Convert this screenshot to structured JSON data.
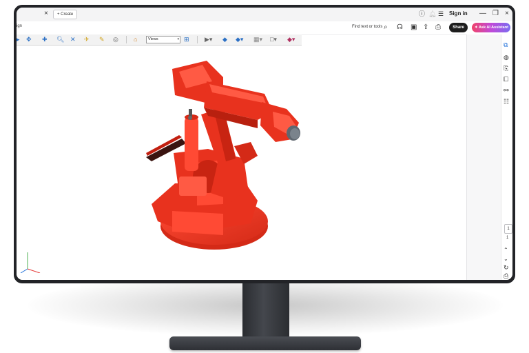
{
  "browser": {
    "tab_close": "×",
    "new_tab_label": "+ Create",
    "sign_in": "Sign in",
    "icons": [
      "info-icon",
      "bell-icon",
      "apps-grid-icon"
    ],
    "window_controls": [
      "—",
      "❐",
      "×"
    ]
  },
  "app_toolbar": {
    "title_fragment": "ign",
    "find_placeholder": "Find text or tools",
    "share_label": "Share",
    "ai_assistant_label": "Ask AI Assistant",
    "icons": [
      "search-icon",
      "headphones-icon",
      "save-icon",
      "upload-icon",
      "print-icon"
    ]
  },
  "toolbar3d": {
    "views_label": "Views",
    "tools": [
      "rotate-icon",
      "pan-icon",
      "zoom-icon",
      "walk-icon",
      "fly-icon",
      "measure-icon",
      "comment-icon",
      "home-icon",
      "model-tree-icon",
      "play-animation-icon",
      "render-mode-icon",
      "lighting-icon",
      "background-icon",
      "cross-section-icon",
      "extra-tools-icon"
    ]
  },
  "viewport": {
    "model_color": "#e8321e",
    "triad_axes": [
      "x",
      "y",
      "z"
    ]
  },
  "right_rail": {
    "icons": [
      "edit-pdf-icon",
      "comment-icon",
      "export-icon",
      "organize-pages-icon",
      "link-icon",
      "compare-icon"
    ],
    "page_current": "1",
    "page_total": "1",
    "nav_icons": [
      "chevron-up-icon",
      "chevron-down-icon",
      "refresh-icon",
      "save-file-icon"
    ]
  }
}
